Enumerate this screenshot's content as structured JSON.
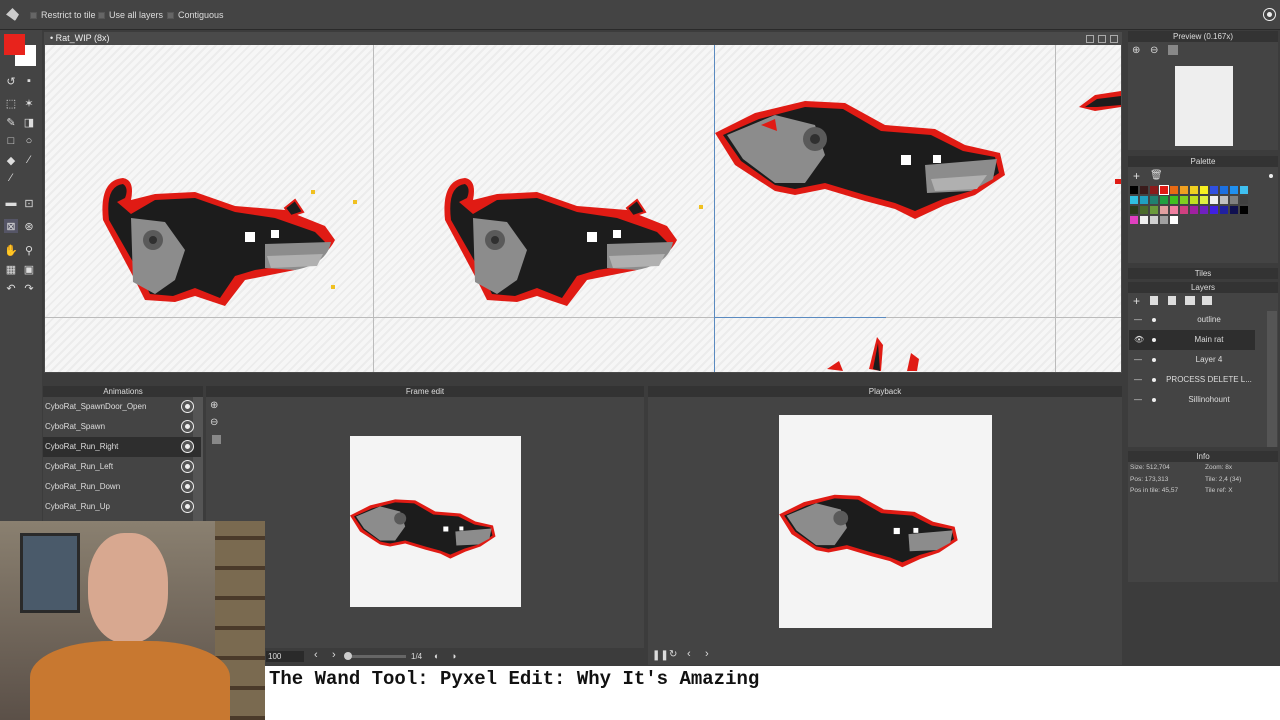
{
  "toolbar": {
    "options": [
      "Restrict to tile",
      "Use all layers",
      "Contiguous"
    ]
  },
  "document": {
    "title": "• Rat_WIP   (8x)"
  },
  "panels": {
    "preview": "Preview (0.167x)",
    "palette": "Palette",
    "tiles": "Tiles",
    "layers": "Layers",
    "info": "Info",
    "animations": "Animations",
    "frame_edit": "Frame edit",
    "playback": "Playback"
  },
  "animations": [
    "CyboRat_SpawnDoor_Open",
    "CyboRat_Spawn",
    "CyboRat_Run_Right",
    "CyboRat_Run_Left",
    "CyboRat_Run_Down",
    "CyboRat_Run_Up"
  ],
  "selected_animation": 2,
  "layers": [
    "outline",
    "Main rat",
    "Layer 4",
    "PROCESS DELETE L...",
    "Sillinohount"
  ],
  "selected_layer": 1,
  "info": {
    "size": "Size: 512,704",
    "zoom": "Zoom: 8x",
    "pos": "Pos: 173,313",
    "tile": "Tile: 2,4 (34)",
    "pos_in_tile": "Pos in tile: 45,57",
    "tile_ref": "Tile ref: X"
  },
  "frame_edit": {
    "speed": "100",
    "frame_counter": "1/4"
  },
  "caption": "The Wand Tool: Pyxel Edit: Why It's Amazing",
  "colors": {
    "primary": "#e8231c",
    "secondary": "#ffffff",
    "outline": "#e01b14",
    "body": "#202020",
    "gray": "#8c8c8c"
  },
  "palette_colors": [
    "#000000",
    "#3a1c1c",
    "#8a1a1a",
    "#e01b14",
    "#e86a14",
    "#f0a020",
    "#f0d020",
    "#f8f020",
    "#3050e0",
    "#1c70e0",
    "#2090f0",
    "#40c0f0",
    "#30c0e0",
    "#20a0c0",
    "#208070",
    "#20a040",
    "#40c020",
    "#80d020",
    "#c0e020",
    "#e0f040",
    "#f0f0f0",
    "#c0c0c0",
    "#808080",
    "#404040",
    "#2a3a1a",
    "#4a6a2a",
    "#6a9a3a",
    "#e0a0a0",
    "#f080a0",
    "#d04080",
    "#a020a0",
    "#7020c0",
    "#4020e0",
    "#2020a0",
    "#101050",
    "#000000",
    "#e040c0",
    "#f0f0f0",
    "#d0d0d0",
    "#a0a0a0",
    "#ffffff"
  ]
}
